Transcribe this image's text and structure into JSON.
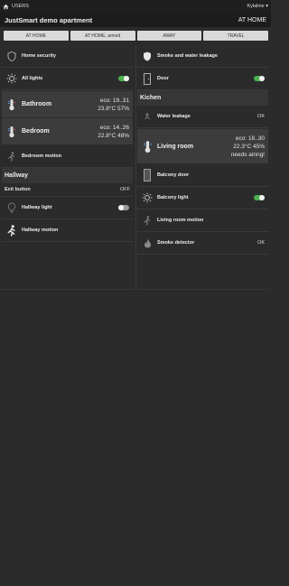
{
  "topbar": {
    "users_label": "USERS",
    "user_name": "Kylaline"
  },
  "header": {
    "title": "JustSmart demo apartment",
    "mode": "AT HOME"
  },
  "modes": [
    "AT HOME",
    "AT HOME, armed",
    "AWAY",
    "TRAVEL"
  ],
  "left": {
    "home_security": "Home security",
    "all_lights": "All lights",
    "bathroom": {
      "name": "Bathroom",
      "eco": "eco: 19..31",
      "reading": "23.8°C 57%"
    },
    "bedroom": {
      "name": "Bedroom",
      "eco": "eco: 14..26",
      "reading": "22.8°C 48%"
    },
    "bedroom_motion": "Bedroom motion",
    "hallway": "Hallway",
    "exit_button": {
      "label": "Exit button",
      "value": "OFF"
    },
    "hallway_light": "Hallway light",
    "hallway_motion": "Hallway motion"
  },
  "right": {
    "smoke_water": "Smoke and water leakage",
    "door": "Door",
    "kitchen": "Kichen",
    "water_leakage": {
      "label": "Water leakage",
      "value": "OK"
    },
    "living_room": {
      "name": "Living room",
      "eco": "eco: 18..30",
      "reading": "22.3°C 45%",
      "status": "needs airing!"
    },
    "balcony_door": "Balcony door",
    "balcony_light": "Balcony light",
    "living_room_motion": "Living room motion",
    "smoke_detector": {
      "label": "Smoke detector",
      "value": "OK"
    }
  },
  "toggles": {
    "all_lights": "on",
    "door": "on",
    "hallway_light": "off",
    "balcony_light": "on"
  },
  "colors": {
    "accent_on": "#4caf50",
    "background": "#2b2b2b",
    "card": "#3c3c3c"
  },
  "icons": [
    "home-icon",
    "shield-icon",
    "light-bulb-icon",
    "thermometer-icon",
    "motion-icon",
    "door-icon",
    "water-drop-icon",
    "fire-icon"
  ]
}
